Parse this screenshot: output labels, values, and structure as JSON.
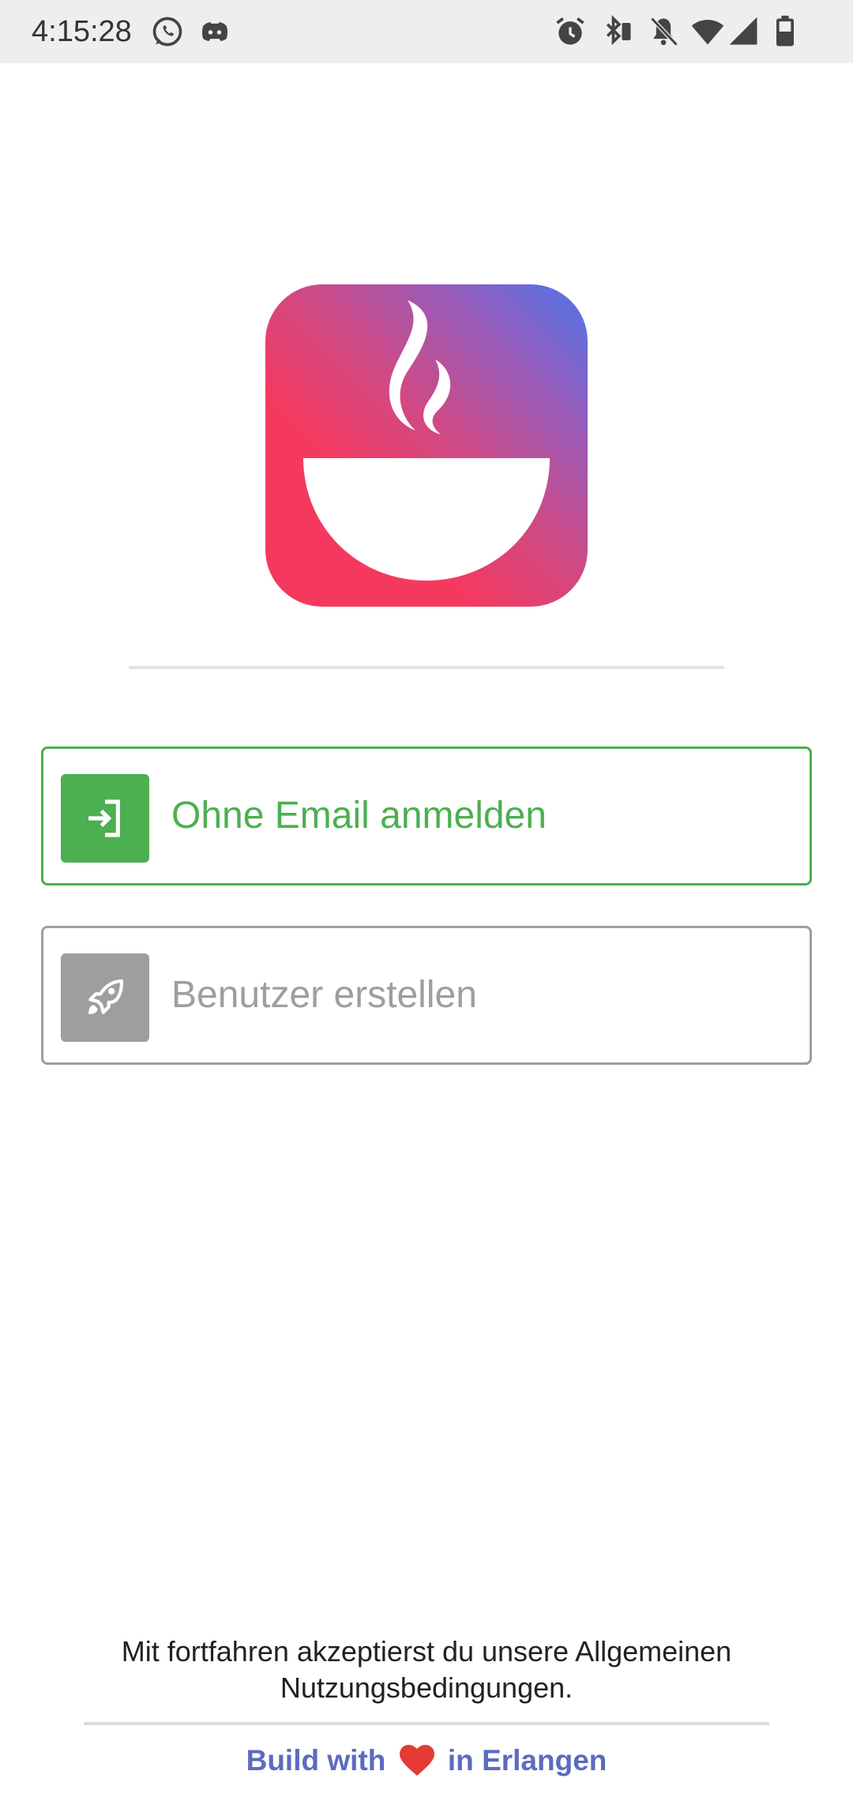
{
  "status_bar": {
    "time": "4:15:28",
    "icons": [
      "whatsapp-icon",
      "discord-icon",
      "alarm-icon",
      "bluetooth-icon",
      "notifications-off-icon",
      "wifi-icon",
      "signal-icon",
      "battery-icon"
    ]
  },
  "logo": {
    "icon": "steaming-bowl-icon",
    "gradient_colors": [
      "#4f74ec",
      "#9a5bb7",
      "#f5395e"
    ]
  },
  "buttons": {
    "login_without_email": {
      "label": "Ohne Email anmelden",
      "icon": "login-arrow-icon",
      "color": "#4caf50"
    },
    "create_user": {
      "label": "Benutzer erstellen",
      "icon": "rocket-icon",
      "color": "#9e9e9e"
    }
  },
  "footer": {
    "terms_line1": "Mit fortfahren akzeptierst du unsere Allgemeinen",
    "terms_line2": "Nutzungsbedingungen.",
    "build_prefix": "Build with",
    "build_suffix": "in Erlangen",
    "heart_icon": "heart-icon",
    "heart_color": "#e53935",
    "link_color": "#5c6bc0"
  }
}
